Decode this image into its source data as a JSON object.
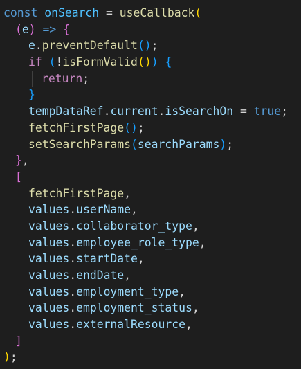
{
  "editor": {
    "language": "javascript",
    "theme": {
      "background": "#1e1e1e",
      "keyword": "#569cd6",
      "control_keyword": "#c586c0",
      "function": "#dcdcaa",
      "variable": "#9cdcfe",
      "bracket_level_1": "#ffd700",
      "bracket_level_2": "#da70d6",
      "bracket_level_3": "#179fff"
    },
    "lines": [
      {
        "tokens": [
          {
            "t": "const",
            "c": "kw"
          },
          {
            "t": " ",
            "c": "punc"
          },
          {
            "t": "onSearch",
            "c": "const"
          },
          {
            "t": " = ",
            "c": "punc"
          },
          {
            "t": "useCallback",
            "c": "fn"
          },
          {
            "t": "(",
            "c": "br1"
          }
        ]
      },
      {
        "tokens": [
          {
            "t": "(",
            "c": "br2"
          },
          {
            "t": "e",
            "c": "var"
          },
          {
            "t": ")",
            "c": "br2"
          },
          {
            "t": " ",
            "c": "punc"
          },
          {
            "t": "=>",
            "c": "kw"
          },
          {
            "t": " ",
            "c": "punc"
          },
          {
            "t": "{",
            "c": "br2"
          }
        ]
      },
      {
        "tokens": [
          {
            "t": "e",
            "c": "var"
          },
          {
            "t": ".",
            "c": "punc"
          },
          {
            "t": "preventDefault",
            "c": "fn"
          },
          {
            "t": "(",
            "c": "br3"
          },
          {
            "t": ")",
            "c": "br3"
          },
          {
            "t": ";",
            "c": "punc"
          }
        ]
      },
      {
        "tokens": [
          {
            "t": "if",
            "c": "ctrl"
          },
          {
            "t": " ",
            "c": "punc"
          },
          {
            "t": "(",
            "c": "br3"
          },
          {
            "t": "!",
            "c": "punc"
          },
          {
            "t": "isFormValid",
            "c": "fn"
          },
          {
            "t": "(",
            "c": "br1"
          },
          {
            "t": ")",
            "c": "br1"
          },
          {
            "t": ")",
            "c": "br3"
          },
          {
            "t": " ",
            "c": "punc"
          },
          {
            "t": "{",
            "c": "br3"
          }
        ]
      },
      {
        "tokens": [
          {
            "t": "return",
            "c": "ctrl"
          },
          {
            "t": ";",
            "c": "punc"
          }
        ]
      },
      {
        "tokens": [
          {
            "t": "}",
            "c": "br3"
          }
        ]
      },
      {
        "tokens": [
          {
            "t": "tempDataRef",
            "c": "var"
          },
          {
            "t": ".",
            "c": "punc"
          },
          {
            "t": "current",
            "c": "var"
          },
          {
            "t": ".",
            "c": "punc"
          },
          {
            "t": "isSearchOn",
            "c": "var"
          },
          {
            "t": " = ",
            "c": "punc"
          },
          {
            "t": "true",
            "c": "kw"
          },
          {
            "t": ";",
            "c": "punc"
          }
        ]
      },
      {
        "tokens": [
          {
            "t": "fetchFirstPage",
            "c": "fn"
          },
          {
            "t": "(",
            "c": "br3"
          },
          {
            "t": ")",
            "c": "br3"
          },
          {
            "t": ";",
            "c": "punc"
          }
        ]
      },
      {
        "tokens": [
          {
            "t": "setSearchParams",
            "c": "fn"
          },
          {
            "t": "(",
            "c": "br3"
          },
          {
            "t": "searchParams",
            "c": "var"
          },
          {
            "t": ")",
            "c": "br3"
          },
          {
            "t": ";",
            "c": "punc"
          }
        ]
      },
      {
        "tokens": [
          {
            "t": "}",
            "c": "br2"
          },
          {
            "t": ",",
            "c": "punc"
          }
        ]
      },
      {
        "tokens": [
          {
            "t": "[",
            "c": "br2"
          }
        ]
      },
      {
        "tokens": [
          {
            "t": "fetchFirstPage",
            "c": "fn"
          },
          {
            "t": ",",
            "c": "punc"
          }
        ]
      },
      {
        "tokens": [
          {
            "t": "values",
            "c": "var"
          },
          {
            "t": ".",
            "c": "punc"
          },
          {
            "t": "userName",
            "c": "var"
          },
          {
            "t": ",",
            "c": "punc"
          }
        ]
      },
      {
        "tokens": [
          {
            "t": "values",
            "c": "var"
          },
          {
            "t": ".",
            "c": "punc"
          },
          {
            "t": "collaborator_type",
            "c": "var"
          },
          {
            "t": ",",
            "c": "punc"
          }
        ]
      },
      {
        "tokens": [
          {
            "t": "values",
            "c": "var"
          },
          {
            "t": ".",
            "c": "punc"
          },
          {
            "t": "employee_role_type",
            "c": "var"
          },
          {
            "t": ",",
            "c": "punc"
          }
        ]
      },
      {
        "tokens": [
          {
            "t": "values",
            "c": "var"
          },
          {
            "t": ".",
            "c": "punc"
          },
          {
            "t": "startDate",
            "c": "var"
          },
          {
            "t": ",",
            "c": "punc"
          }
        ]
      },
      {
        "tokens": [
          {
            "t": "values",
            "c": "var"
          },
          {
            "t": ".",
            "c": "punc"
          },
          {
            "t": "endDate",
            "c": "var"
          },
          {
            "t": ",",
            "c": "punc"
          }
        ]
      },
      {
        "tokens": [
          {
            "t": "values",
            "c": "var"
          },
          {
            "t": ".",
            "c": "punc"
          },
          {
            "t": "employment_type",
            "c": "var"
          },
          {
            "t": ",",
            "c": "punc"
          }
        ]
      },
      {
        "tokens": [
          {
            "t": "values",
            "c": "var"
          },
          {
            "t": ".",
            "c": "punc"
          },
          {
            "t": "employment_status",
            "c": "var"
          },
          {
            "t": ",",
            "c": "punc"
          }
        ]
      },
      {
        "tokens": [
          {
            "t": "values",
            "c": "var"
          },
          {
            "t": ".",
            "c": "punc"
          },
          {
            "t": "externalResource",
            "c": "var"
          },
          {
            "t": ",",
            "c": "punc"
          }
        ]
      },
      {
        "tokens": [
          {
            "t": "]",
            "c": "br2"
          }
        ]
      },
      {
        "tokens": [
          {
            "t": ")",
            "c": "br1"
          },
          {
            "t": ";",
            "c": "punc"
          }
        ]
      }
    ]
  }
}
